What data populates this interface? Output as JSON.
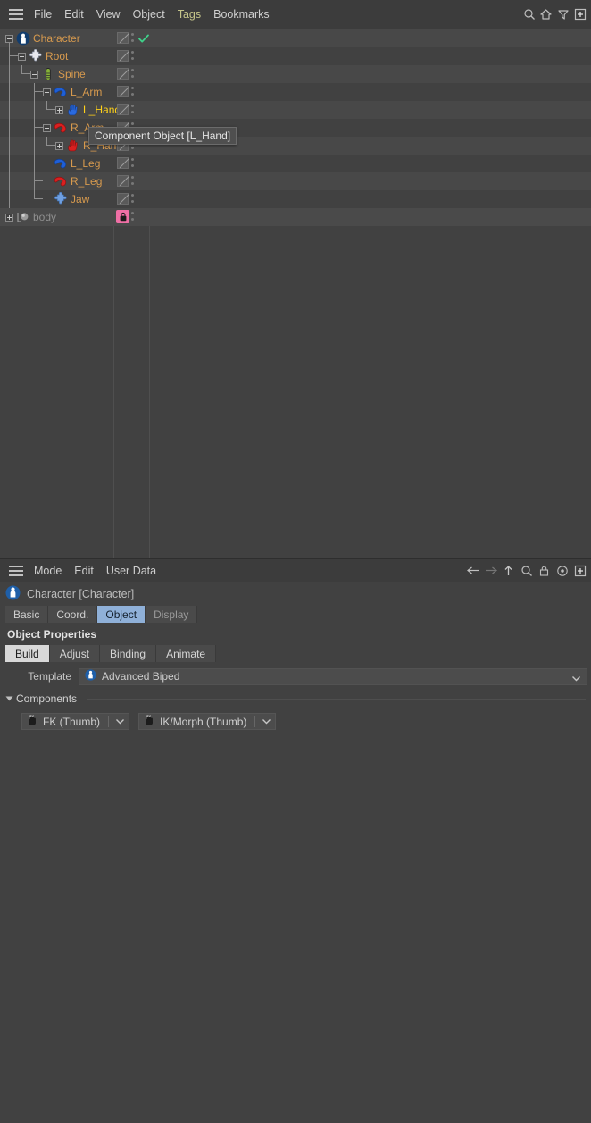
{
  "menubar": {
    "hamburger_icon": "hamburger-icon",
    "items": [
      {
        "label": "File",
        "accent": false
      },
      {
        "label": "Edit",
        "accent": false
      },
      {
        "label": "View",
        "accent": false
      },
      {
        "label": "Object",
        "accent": false
      },
      {
        "label": "Tags",
        "accent": true
      },
      {
        "label": "Bookmarks",
        "accent": false
      }
    ],
    "right_icons": [
      "search-icon",
      "home-icon",
      "filter-icon",
      "add-box-icon"
    ]
  },
  "object_manager": {
    "rows": [
      {
        "name": "Character",
        "icon": "character-icon",
        "depth": 0,
        "expander": "minus",
        "color": "#d79a4e",
        "selected": false,
        "has_check": true,
        "has_tag": true,
        "has_dots": true
      },
      {
        "name": "Root",
        "icon": "puzzle-white-icon",
        "depth": 1,
        "expander": "minus",
        "color": "#d79a4e",
        "selected": false,
        "has_check": false,
        "has_tag": true,
        "has_dots": true
      },
      {
        "name": "Spine",
        "icon": "spine-icon",
        "depth": 2,
        "expander": "minus",
        "color": "#d79a4e",
        "selected": false,
        "has_check": false,
        "has_tag": true,
        "has_dots": true
      },
      {
        "name": "L_Arm",
        "icon": "arm-blue-icon",
        "depth": 3,
        "expander": "minus",
        "color": "#d79a4e",
        "selected": false,
        "has_check": false,
        "has_tag": true,
        "has_dots": true
      },
      {
        "name": "L_Hand",
        "icon": "hand-blue-icon",
        "depth": 4,
        "expander": "plus",
        "color": "#ffd11a",
        "selected": true,
        "has_check": false,
        "has_tag": true,
        "has_dots": true
      },
      {
        "name": "R_Arm",
        "icon": "arm-red-icon",
        "depth": 3,
        "expander": "minus",
        "color": "#d79a4e",
        "selected": false,
        "has_check": false,
        "has_tag": true,
        "has_dots": true
      },
      {
        "name": "R_Hand",
        "icon": "hand-red-icon",
        "depth": 4,
        "expander": "plus",
        "color": "#d79a4e",
        "selected": false,
        "has_check": false,
        "has_tag": true,
        "has_dots": true
      },
      {
        "name": "L_Leg",
        "icon": "leg-blue-icon",
        "depth": 3,
        "expander": "none",
        "color": "#d79a4e",
        "selected": false,
        "has_check": false,
        "has_tag": true,
        "has_dots": true
      },
      {
        "name": "R_Leg",
        "icon": "leg-red-icon",
        "depth": 3,
        "expander": "none",
        "color": "#d79a4e",
        "selected": false,
        "has_check": false,
        "has_tag": true,
        "has_dots": true
      },
      {
        "name": "Jaw",
        "icon": "puzzle-blue-icon",
        "depth": 3,
        "expander": "none",
        "color": "#d79a4e",
        "selected": false,
        "has_check": false,
        "has_tag": true,
        "has_dots": true
      },
      {
        "name": "body",
        "icon": "polygon-object-icon",
        "depth": 0,
        "expander": "plus",
        "color": "#8f8f8f",
        "selected": false,
        "has_check": false,
        "has_tag": false,
        "has_dots": true,
        "locked": true
      }
    ],
    "tooltip": "Component Object [L_Hand]"
  },
  "attribute_manager": {
    "toolbar": {
      "hamburger_icon": "hamburger-icon",
      "menus": [
        "Mode",
        "Edit",
        "User Data"
      ],
      "right_icons": [
        "back-arrow-icon",
        "forward-arrow-icon",
        "up-arrow-icon",
        "search-icon",
        "lock-icon",
        "target-icon",
        "add-box-icon"
      ]
    },
    "object_header": {
      "icon": "character-icon",
      "title": "Character [Character]"
    },
    "tabs": [
      {
        "label": "Basic",
        "selected": false,
        "dim": false
      },
      {
        "label": "Coord.",
        "selected": false,
        "dim": false
      },
      {
        "label": "Object",
        "selected": true,
        "dim": false
      },
      {
        "label": "Display",
        "selected": false,
        "dim": true
      }
    ],
    "section_title": "Object Properties",
    "subtabs": [
      {
        "label": "Build",
        "selected": true
      },
      {
        "label": "Adjust",
        "selected": false
      },
      {
        "label": "Binding",
        "selected": false
      },
      {
        "label": "Animate",
        "selected": false
      }
    ],
    "template": {
      "label": "Template",
      "value": "Advanced Biped",
      "icon": "character-icon",
      "chevron": "chevron-down-icon"
    },
    "components": {
      "group_label": "Components",
      "buttons": [
        {
          "label": "FK (Thumb)",
          "icon": "hand-dark-icon",
          "chevron": "chevron-down-icon"
        },
        {
          "label": "IK/Morph (Thumb)",
          "icon": "hand-dark-icon",
          "chevron": "chevron-down-icon"
        }
      ]
    }
  },
  "colors": {
    "accent_select": "#8fb0d8",
    "node_orange": "#d79a4e",
    "node_selected": "#ffd11a",
    "lock_pink": "#ef6fa5",
    "check_green": "#3fd18a"
  }
}
